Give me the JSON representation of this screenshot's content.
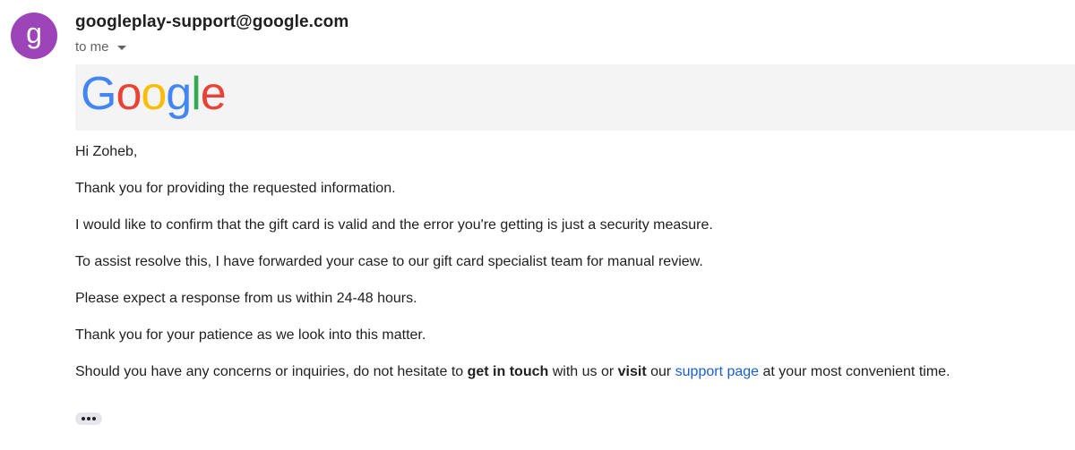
{
  "avatar": {
    "letter": "g",
    "color": "#9c44b8"
  },
  "sender": {
    "email": "googleplay-support@google.com"
  },
  "recipient": {
    "label": "to me",
    "dropdown_icon": "caret-down-icon"
  },
  "logo": {
    "letters": [
      {
        "char": "G",
        "color": "#4285F4"
      },
      {
        "char": "o",
        "color": "#EA4335"
      },
      {
        "char": "o",
        "color": "#FBBC05"
      },
      {
        "char": "g",
        "color": "#4285F4"
      },
      {
        "char": "l",
        "color": "#34A853"
      },
      {
        "char": "e",
        "color": "#EA4335"
      }
    ]
  },
  "message": {
    "greeting": "Hi Zoheb,",
    "line1": "Thank you for providing the requested information.",
    "line2": "I would like to confirm that the gift card is valid and the error you're getting is just a security measure.",
    "line3": "To assist resolve this, I have forwarded your case to our gift card specialist team for manual review.",
    "line4": "Please expect a response from us within 24-48 hours.",
    "line5": "Thank you for your patience as we look into this matter.",
    "closing": {
      "part1": "Should you have any concerns or inquiries, do not hesitate to ",
      "bold1": "get in touch",
      "part2": " with us or ",
      "bold2": "visit",
      "part3": " our ",
      "link": "support page",
      "part4": " at your most convenient time."
    }
  },
  "trimmed_content": {
    "icon": "more-horizontal-icon"
  }
}
